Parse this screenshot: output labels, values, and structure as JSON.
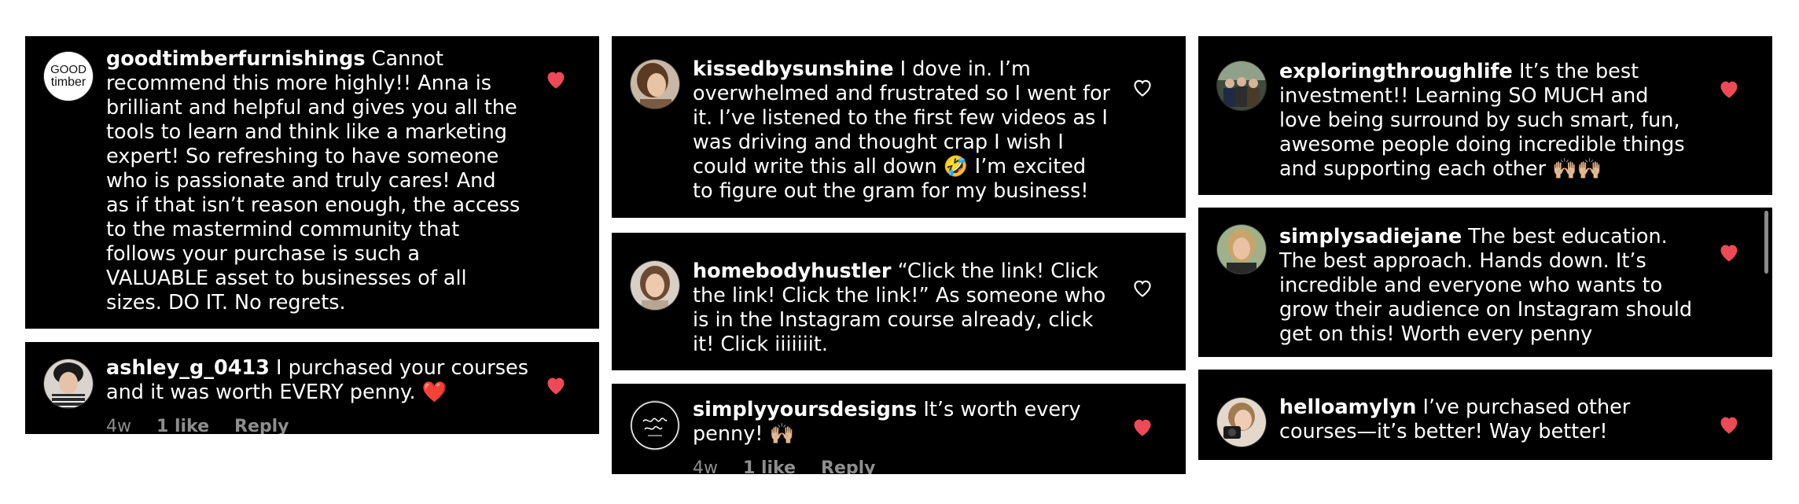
{
  "comments": [
    {
      "username": "goodtimberfurnishings",
      "avatar_text": [
        "GOOD",
        "timber"
      ],
      "lines": [
        "Cannot",
        "recommend this more highly!! Anna is",
        "brilliant and helpful and gives you all the",
        "tools to learn and think like a marketing",
        "expert! So refreshing to have someone",
        "who is passionate and truly cares! And",
        "as if that isn’t reason enough, the access",
        "to the mastermind community that",
        "follows your purchase is such a",
        "VALUABLE asset to businesses of all",
        "sizes. DO IT. No regrets."
      ],
      "liked": true
    },
    {
      "username": "ashley_g_0413",
      "lines": [
        "I purchased your courses",
        "and it was worth EVERY penny. ❤️"
      ],
      "liked": true,
      "meta": {
        "time": "4w",
        "likes": "1 like",
        "reply": "Reply"
      }
    },
    {
      "username": "kissedbysunshine",
      "lines": [
        "I dove in. I’m",
        "overwhelmed and frustrated so I went for",
        "it. I’ve listened to the first few videos as I",
        "was driving and thought crap I wish I",
        "could write this all down 🤣 I’m excited",
        "to figure out the gram for my business!"
      ],
      "liked": false
    },
    {
      "username": "homebodyhustler",
      "lines": [
        "“Click the link! Click",
        "the link! Click the link!” As someone who",
        "is in the Instagram course already, click",
        "it! Click iiiiiiit."
      ],
      "liked": false
    },
    {
      "username": "simplyyoursdesigns",
      "lines": [
        "It’s worth every",
        "penny! 🙌🏼"
      ],
      "liked": true,
      "meta": {
        "time": "4w",
        "likes": "1 like",
        "reply": "Reply"
      }
    },
    {
      "username": "exploringthroughlife",
      "lines": [
        "It’s the best",
        "investment!! Learning SO MUCH and",
        "love being surround by such smart, fun,",
        "awesome people doing incredible things",
        "and supporting each other 🙌🏼🙌🏼"
      ],
      "liked": true
    },
    {
      "username": "simplysadiejane",
      "lines": [
        "The best education.",
        "The best approach. Hands down. It’s",
        "incredible and everyone who wants to",
        "grow their audience on Instagram should",
        "get on this! Worth every penny"
      ],
      "liked": true
    },
    {
      "username": "helloamylyn",
      "lines": [
        "I’ve purchased other",
        "courses—it’s better!  Way better!"
      ],
      "liked": true
    }
  ],
  "colors": {
    "heart_liked": "#ed4956",
    "heart_outline": "#ffffff",
    "meta_text": "#8e8e8e",
    "card_bg": "#000000"
  }
}
